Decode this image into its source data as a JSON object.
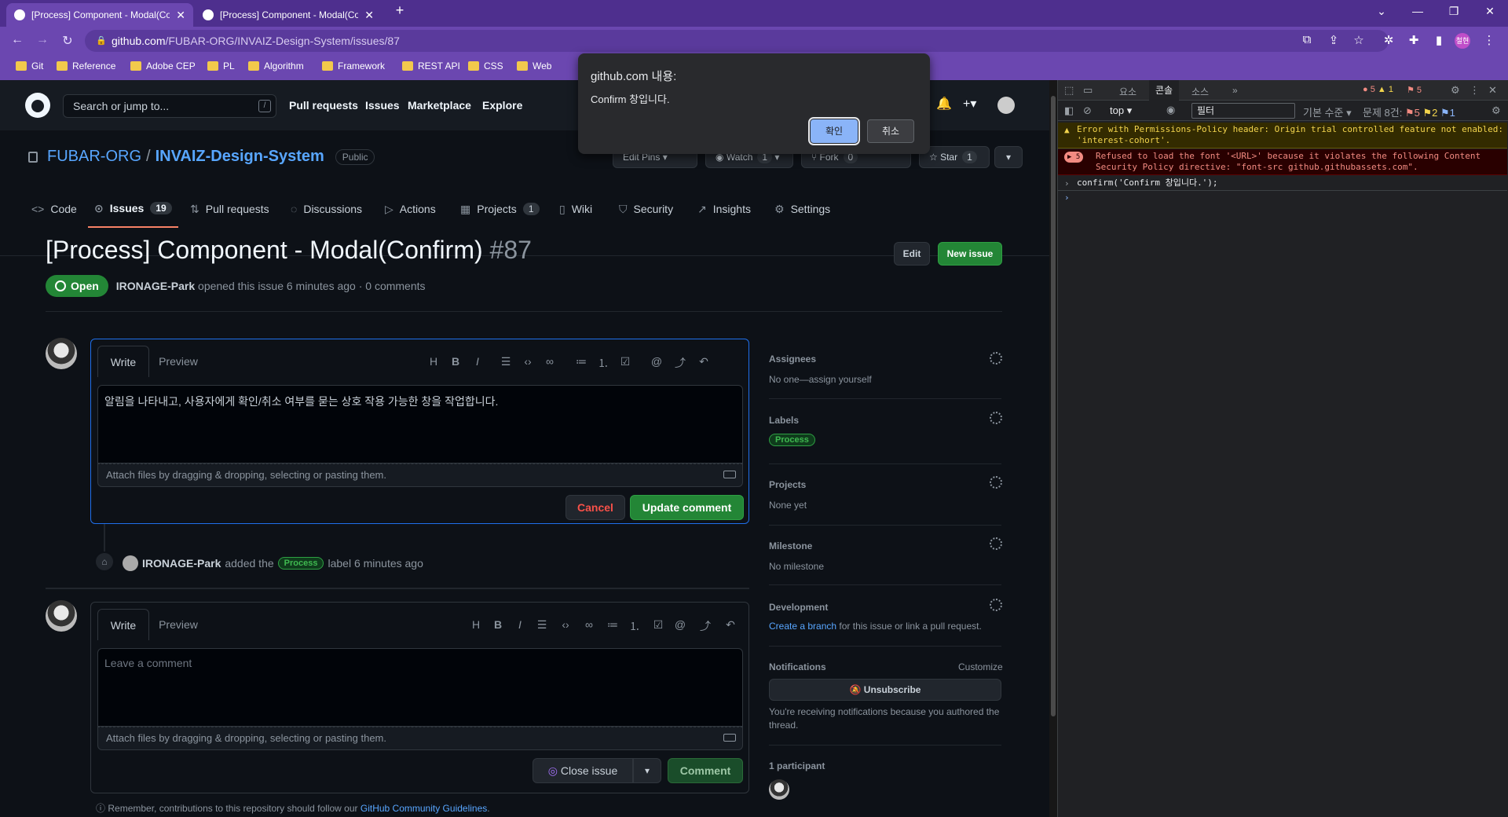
{
  "browser": {
    "tabs": [
      {
        "title": "[Process] Component - Modal(Co"
      },
      {
        "title": "[Process] Component - Modal(Co"
      }
    ],
    "url_host": "github.com",
    "url_path": "/FUBAR-ORG/INVAIZ-Design-System/issues/87",
    "profile": "철현",
    "bookmarks": [
      "Git",
      "Reference",
      "Adobe CEP",
      "PL",
      "Algorithm",
      "Framework",
      "REST API",
      "CSS",
      "Web"
    ]
  },
  "header": {
    "search_placeholder": "Search or jump to...",
    "slash": "/",
    "nav": [
      "Pull requests",
      "Issues",
      "Marketplace",
      "Explore"
    ]
  },
  "repo": {
    "owner": "FUBAR-ORG",
    "sep": "/",
    "name": "INVAIZ-Design-System",
    "visibility": "Public",
    "edit_pins": "Edit Pins",
    "watch": "Watch",
    "watch_count": "1",
    "fork": "Fork",
    "fork_count": "0",
    "star": "Star",
    "star_count": "1",
    "tabs": [
      {
        "label": "Code",
        "icon": "<>"
      },
      {
        "label": "Issues",
        "icon": "⊙",
        "count": "19"
      },
      {
        "label": "Pull requests",
        "icon": "⇅"
      },
      {
        "label": "Discussions",
        "icon": "◌"
      },
      {
        "label": "Actions",
        "icon": "▷"
      },
      {
        "label": "Projects",
        "icon": "▦",
        "count": "1"
      },
      {
        "label": "Wiki",
        "icon": "▯"
      },
      {
        "label": "Security",
        "icon": "⛉"
      },
      {
        "label": "Insights",
        "icon": "↗"
      },
      {
        "label": "Settings",
        "icon": "⚙"
      }
    ]
  },
  "issue": {
    "title": "[Process] Component - Modal(Confirm)",
    "number": "#87",
    "edit": "Edit",
    "new_issue": "New issue",
    "state": "Open",
    "author": "IRONAGE-Park",
    "meta": "opened this issue 6 minutes ago · 0 comments"
  },
  "editor1": {
    "write": "Write",
    "preview": "Preview",
    "body": "알림을 나타내고, 사용자에게 확인/취소 여부를 묻는 상호 작용 가능한 창을 작업합니다.",
    "attach": "Attach files by dragging & dropping, selecting or pasting them.",
    "cancel": "Cancel",
    "update": "Update comment"
  },
  "event": {
    "author": "IRONAGE-Park",
    "added_the": "added the",
    "label": "Process",
    "suffix": "label 6 minutes ago"
  },
  "editor2": {
    "write": "Write",
    "preview": "Preview",
    "placeholder": "Leave a comment",
    "attach": "Attach files by dragging & dropping, selecting or pasting them.",
    "close_issue": "Close issue",
    "comment": "Comment",
    "remember_prefix": "Remember, contributions to this repository should follow our",
    "remember_link": "GitHub Community Guidelines",
    "remember_suffix": "."
  },
  "sidebar": {
    "assignees_h": "Assignees",
    "assignees_v": "No one—assign yourself",
    "labels_h": "Labels",
    "labels_v": "Process",
    "projects_h": "Projects",
    "projects_v": "None yet",
    "milestone_h": "Milestone",
    "milestone_v": "No milestone",
    "development_h": "Development",
    "development_link": "Create a branch",
    "development_v": "for this issue or link a pull request.",
    "notifications_h": "Notifications",
    "customize": "Customize",
    "unsubscribe": "Unsubscribe",
    "notif_note": "You're receiving notifications because you authored the thread.",
    "participants_h": "1 participant"
  },
  "dialog": {
    "title": "github.com 내용:",
    "message": "Confirm 창입니다.",
    "ok": "확인",
    "cancel": "취소"
  },
  "devtools": {
    "tabs": [
      "요소",
      "콘솔",
      "소스"
    ],
    "more": "»",
    "err_count": "5",
    "warn_count": "1",
    "issue_count": "5",
    "context": "top",
    "filter_placeholder": "필터",
    "levels": "기본 수준",
    "issues_label": "문제 8건:",
    "issues_err": "5",
    "issues_warn": "2",
    "issues_info": "1",
    "warn_line": "Error with Permissions-Policy header: Origin trial controlled feature not enabled: 'interest-cohort'.",
    "err_badge": "5",
    "err_line": "Refused to load the font '<URL>' because it violates the following Content Security Policy directive: \"font-src github.githubassets.com\".",
    "cmd_line": "confirm('Confirm 창입니다.');"
  }
}
